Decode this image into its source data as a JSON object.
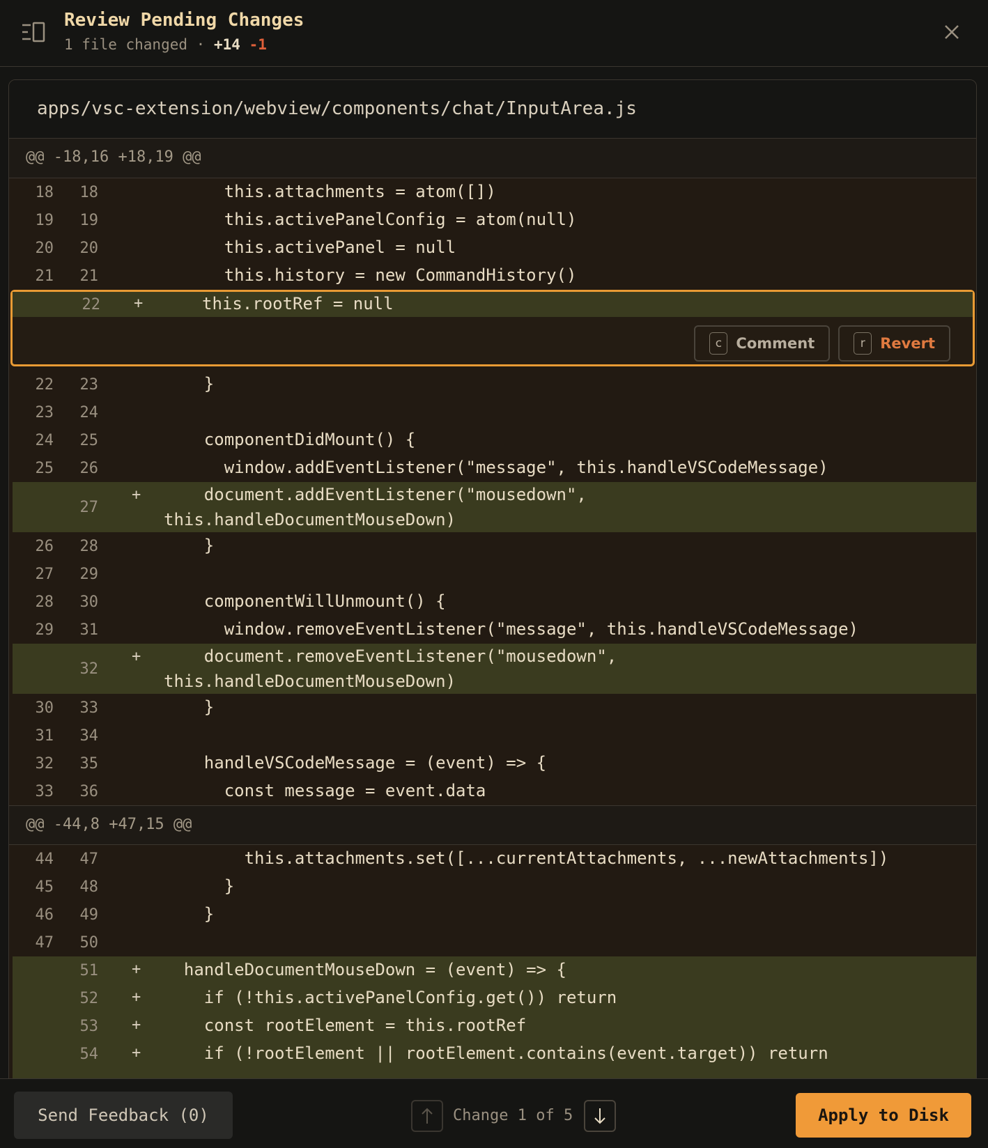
{
  "header": {
    "title": "Review Pending Changes",
    "files_changed": "1 file changed",
    "separator": "·",
    "additions": "+14",
    "deletions": "-1",
    "panel_icon": "sidebar-toggle-icon",
    "close_icon": "close-icon"
  },
  "file": {
    "path": "apps/vsc-extension/webview/components/chat/InputArea.js"
  },
  "hunks": [
    {
      "header": "@@ -18,16 +18,19 @@",
      "lines": [
        {
          "old": "18",
          "new": "18",
          "marker": "",
          "code": "      this.attachments = atom([])"
        },
        {
          "old": "19",
          "new": "19",
          "marker": "",
          "code": "      this.activePanelConfig = atom(null)"
        },
        {
          "old": "20",
          "new": "20",
          "marker": "",
          "code": "      this.activePanel = null"
        },
        {
          "old": "21",
          "new": "21",
          "marker": "",
          "code": "      this.history = new CommandHistory()"
        },
        {
          "old": "",
          "new": "22",
          "marker": "+",
          "code": "this.rootRef = null",
          "selected": true
        },
        {
          "old": "22",
          "new": "23",
          "marker": "",
          "code": "    }"
        },
        {
          "old": "23",
          "new": "24",
          "marker": "",
          "code": ""
        },
        {
          "old": "24",
          "new": "25",
          "marker": "",
          "code": "    componentDidMount() {"
        },
        {
          "old": "25",
          "new": "26",
          "marker": "",
          "code": "      window.addEventListener(\"message\", this.handleVSCodeMessage)"
        },
        {
          "old": "",
          "new": "27",
          "marker": "+",
          "code": "    document.addEventListener(\"mousedown\",\nthis.handleDocumentMouseDown)"
        },
        {
          "old": "26",
          "new": "28",
          "marker": "",
          "code": "    }"
        },
        {
          "old": "27",
          "new": "29",
          "marker": "",
          "code": ""
        },
        {
          "old": "28",
          "new": "30",
          "marker": "",
          "code": "    componentWillUnmount() {"
        },
        {
          "old": "29",
          "new": "31",
          "marker": "",
          "code": "      window.removeEventListener(\"message\", this.handleVSCodeMessage)"
        },
        {
          "old": "",
          "new": "32",
          "marker": "+",
          "code": "    document.removeEventListener(\"mousedown\",\nthis.handleDocumentMouseDown)"
        },
        {
          "old": "30",
          "new": "33",
          "marker": "",
          "code": "    }"
        },
        {
          "old": "31",
          "new": "34",
          "marker": "",
          "code": ""
        },
        {
          "old": "32",
          "new": "35",
          "marker": "",
          "code": "    handleVSCodeMessage = (event) => {"
        },
        {
          "old": "33",
          "new": "36",
          "marker": "",
          "code": "      const message = event.data"
        }
      ]
    },
    {
      "header": "@@ -44,8 +47,15 @@",
      "lines": [
        {
          "old": "44",
          "new": "47",
          "marker": "",
          "code": "        this.attachments.set([...currentAttachments, ...newAttachments])"
        },
        {
          "old": "45",
          "new": "48",
          "marker": "",
          "code": "      }"
        },
        {
          "old": "46",
          "new": "49",
          "marker": "",
          "code": "    }"
        },
        {
          "old": "47",
          "new": "50",
          "marker": "",
          "code": ""
        },
        {
          "old": "",
          "new": "51",
          "marker": "+",
          "code": "  handleDocumentMouseDown = (event) => {"
        },
        {
          "old": "",
          "new": "52",
          "marker": "+",
          "code": "    if (!this.activePanelConfig.get()) return"
        },
        {
          "old": "",
          "new": "53",
          "marker": "+",
          "code": "    const rootElement = this.rootRef"
        },
        {
          "old": "",
          "new": "54",
          "marker": "+",
          "code": "    if (!rootElement || rootElement.contains(event.target)) return"
        }
      ]
    }
  ],
  "actions": {
    "comment_key": "c",
    "comment_label": "Comment",
    "revert_key": "r",
    "revert_label": "Revert"
  },
  "footer": {
    "feedback_label": "Send Feedback (0)",
    "change_counter": "Change 1 of 5",
    "apply_label": "Apply to Disk",
    "prev_icon": "arrow-up-icon",
    "next_icon": "arrow-down-icon"
  },
  "colors": {
    "accent": "#f09a38",
    "added_bg": "#3a3b1f",
    "deletion": "#e0603a",
    "revert": "#e07a40"
  }
}
